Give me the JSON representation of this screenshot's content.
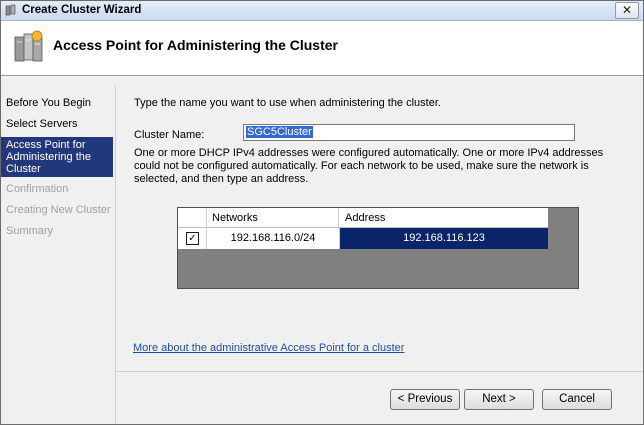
{
  "window": {
    "title": "Create Cluster Wizard",
    "close_glyph": "✕"
  },
  "header": {
    "title": "Access Point for Administering the Cluster",
    "icon": "cluster-servers-icon"
  },
  "sidebar": {
    "items": [
      {
        "label": "Before You Begin",
        "state": "normal"
      },
      {
        "label": "Select Servers",
        "state": "normal"
      },
      {
        "label": "Access Point for Administering the Cluster",
        "state": "active"
      },
      {
        "label": "Confirmation",
        "state": "disabled"
      },
      {
        "label": "Creating New Cluster",
        "state": "disabled"
      },
      {
        "label": "Summary",
        "state": "disabled"
      }
    ]
  },
  "main": {
    "instruction": "Type the name you want to use when administering the cluster.",
    "cluster_name_label": "Cluster Name:",
    "cluster_name_value": "SGC5Cluster",
    "description": "One or more DHCP IPv4 addresses were configured automatically.  One or more IPv4 addresses could not be configured automatically.  For each network to be used, make sure the network is selected, and then type an address.",
    "grid": {
      "columns": [
        "Networks",
        "Address"
      ],
      "rows": [
        {
          "checked": true,
          "network": "192.168.116.0/24",
          "address": "192.168.116.123"
        }
      ]
    },
    "link": "More about the administrative Access Point for a cluster"
  },
  "footer": {
    "previous": "< Previous",
    "next": "Next >",
    "cancel": "Cancel"
  },
  "colors": {
    "selection": "#23377c",
    "address_highlight": "#0a246a",
    "link": "#1d4fa8"
  }
}
